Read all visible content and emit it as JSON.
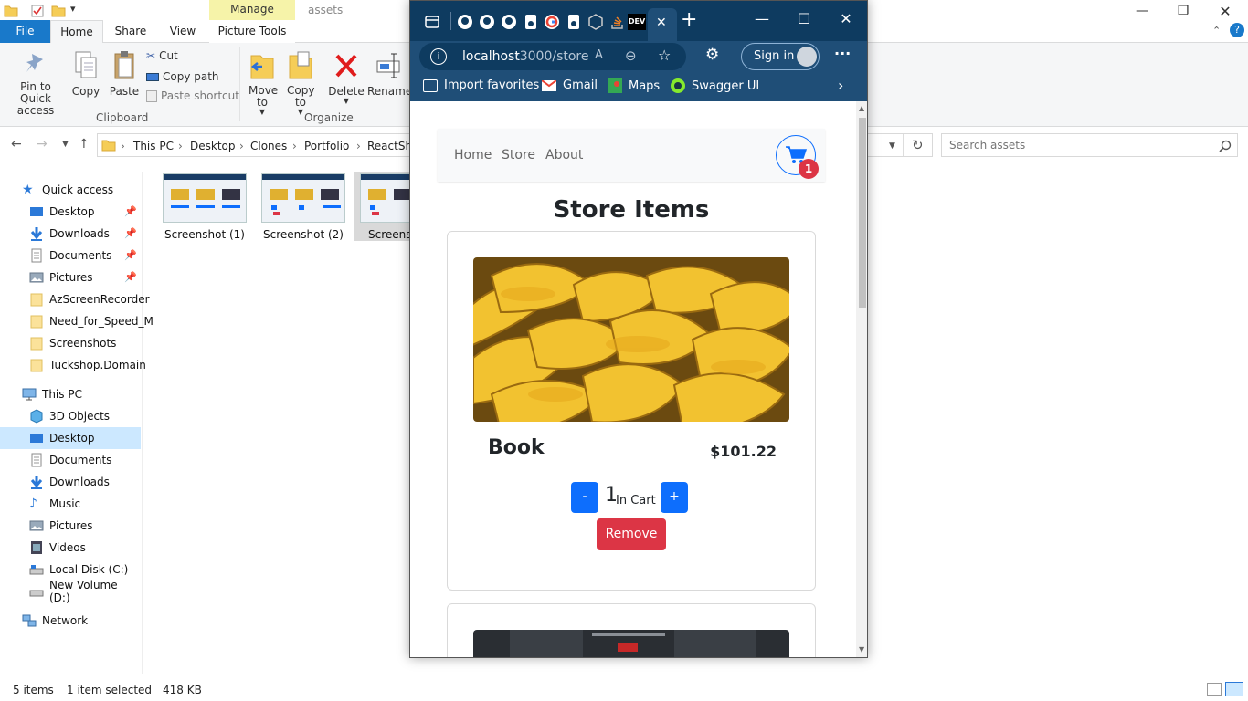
{
  "explorer": {
    "title_tab": "Manage",
    "folder_title": "assets",
    "tabs": {
      "file": "File",
      "home": "Home",
      "share": "Share",
      "view": "View",
      "picture_tools": "Picture Tools"
    },
    "ribbon": {
      "pin_label": "Pin to Quick access",
      "copy_label": "Copy",
      "paste_label": "Paste",
      "cut_label": "Cut",
      "copy_path_label": "Copy path",
      "paste_shortcut_label": "Paste shortcut",
      "clipboard_group": "Clipboard",
      "move_to_label": "Move to",
      "copy_to_label": "Copy to",
      "delete_label": "Delete",
      "rename_label": "Rename",
      "organize_group": "Organize"
    },
    "breadcrumbs": [
      "This PC",
      "Desktop",
      "Clones",
      "Portfolio",
      "ReactSho"
    ],
    "search_placeholder": "Search assets",
    "nav": {
      "quick_access": "Quick access",
      "quick_items": [
        "Desktop",
        "Downloads",
        "Documents",
        "Pictures",
        "AzScreenRecorder",
        "Need_for_Speed_M",
        "Screenshots",
        "Tuckshop.Domain"
      ],
      "this_pc": "This PC",
      "pc_items": [
        "3D Objects",
        "Desktop",
        "Documents",
        "Downloads",
        "Music",
        "Pictures",
        "Videos",
        "Local Disk (C:)",
        "New Volume (D:)"
      ],
      "network": "Network"
    },
    "files": [
      "Screenshot (1)",
      "Screenshot (2)",
      "Screensh"
    ],
    "status": {
      "count": "5 items",
      "selected": "1 item selected",
      "size": "418 KB"
    }
  },
  "browser": {
    "url_host": "localhost",
    "url_path": ":3000/store",
    "sign_in": "Sign in",
    "dev_tab": "DEV",
    "favorites": [
      "Import favorites",
      "Gmail",
      "Maps",
      "Swagger UI"
    ],
    "site": {
      "nav_links": [
        "Home",
        "Store",
        "About"
      ],
      "cart_count": "1",
      "page_title": "Store Items",
      "item": {
        "name": "Book",
        "price": "$101.22",
        "minus": "-",
        "plus": "+",
        "quantity": "1",
        "in_cart": "In Cart",
        "remove": "Remove"
      }
    }
  },
  "colors": {
    "accent": "#0d6efd",
    "danger": "#dc3545",
    "edge_dark": "#0e3b60",
    "edge_toolbar": "#1f4e77",
    "explorer_file": "#1979ca"
  }
}
